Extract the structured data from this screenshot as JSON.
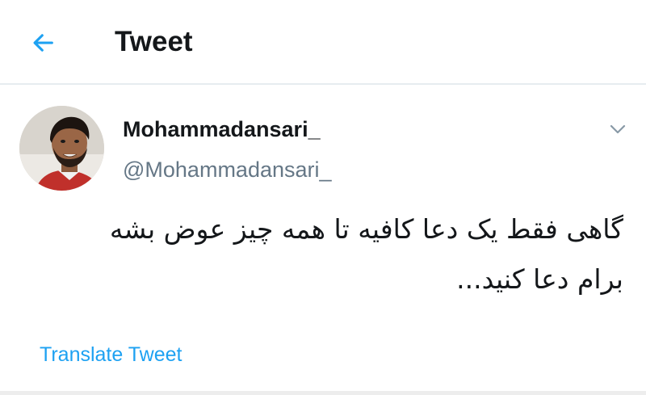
{
  "header": {
    "back_icon": "arrow-left-icon",
    "title": "Tweet"
  },
  "tweet": {
    "author": {
      "display_name": "Mohammadansari_",
      "handle": "@Mohammadansari_"
    },
    "menu_icon": "chevron-down-icon",
    "text_line_1": "گاهی فقط یک دعا کافیه تا همه چیز عوض بشه",
    "text_line_2": "برام دعا کنید...",
    "translate_label": "Translate Tweet"
  },
  "colors": {
    "accent": "#1da1f2",
    "text_primary": "#14171a",
    "text_secondary": "#657786",
    "divider": "#e6ecf0"
  }
}
